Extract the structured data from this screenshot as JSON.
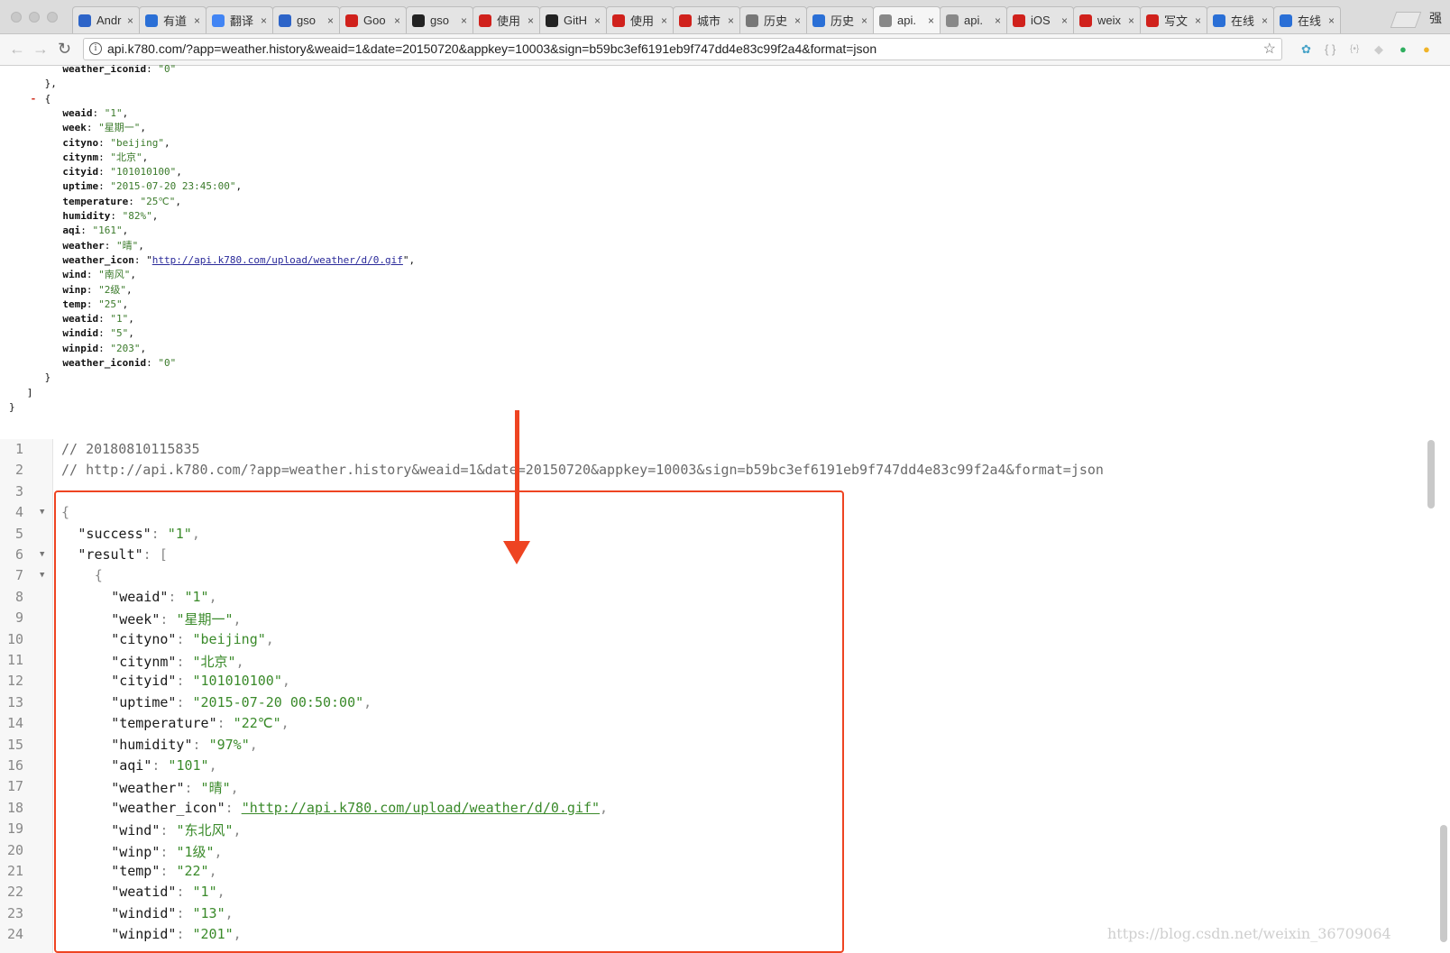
{
  "tabs": [
    {
      "title": "Andr",
      "icon": "paw-icon",
      "color": "#2d64c8"
    },
    {
      "title": "有道",
      "icon": "note-icon",
      "color": "#2a6fd6"
    },
    {
      "title": "翻译",
      "icon": "google-icon",
      "color": "#4285f4"
    },
    {
      "title": "gso",
      "icon": "paw-icon",
      "color": "#2d64c8"
    },
    {
      "title": "Goo",
      "icon": "csdn-icon",
      "color": "#d0211c"
    },
    {
      "title": "gso",
      "icon": "github-icon",
      "color": "#222222"
    },
    {
      "title": "使用",
      "icon": "csdn-icon",
      "color": "#d0211c"
    },
    {
      "title": "GitH",
      "icon": "github-icon",
      "color": "#222222"
    },
    {
      "title": "使用",
      "icon": "csdn-icon",
      "color": "#d0211c"
    },
    {
      "title": "城市",
      "icon": "csdn-icon",
      "color": "#d0211c"
    },
    {
      "title": "历史",
      "icon": "page-icon",
      "color": "#777777"
    },
    {
      "title": "历史",
      "icon": "share-icon",
      "color": "#2a6fd6"
    },
    {
      "title": "api.",
      "icon": "k-icon",
      "color": "#888888"
    },
    {
      "title": "api.",
      "icon": "k-icon",
      "color": "#888888"
    },
    {
      "title": "iOS",
      "icon": "csdn-icon",
      "color": "#d0211c"
    },
    {
      "title": "weix",
      "icon": "csdn-icon",
      "color": "#d0211c"
    },
    {
      "title": "写文",
      "icon": "csdn-icon",
      "color": "#d0211c"
    },
    {
      "title": "在线",
      "icon": "code-icon",
      "color": "#2a6fd6"
    },
    {
      "title": "在线",
      "icon": "code-icon",
      "color": "#2a6fd6"
    }
  ],
  "profile_label": "强",
  "url": "api.k780.com/?app=weather.history&weaid=1&date=20150720&appkey=10003&sign=b59bc3ef6191eb9f747dd4e83c99f2a4&format=json",
  "raw_lines": [
    {
      "indent": 9,
      "key": "weather_iconid",
      "value": "\"0\"",
      "trail": ""
    },
    {
      "indent": 6,
      "plain": "},"
    },
    {
      "indent": 6,
      "plain": "{",
      "minus": "-"
    },
    {
      "indent": 9,
      "key": "weaid",
      "value": "\"1\"",
      "trail": ","
    },
    {
      "indent": 9,
      "key": "week",
      "value": "\"星期一\"",
      "trail": ","
    },
    {
      "indent": 9,
      "key": "cityno",
      "value": "\"beijing\"",
      "trail": ","
    },
    {
      "indent": 9,
      "key": "citynm",
      "value": "\"北京\"",
      "trail": ","
    },
    {
      "indent": 9,
      "key": "cityid",
      "value": "\"101010100\"",
      "trail": ","
    },
    {
      "indent": 9,
      "key": "uptime",
      "value": "\"2015-07-20 23:45:00\"",
      "trail": ","
    },
    {
      "indent": 9,
      "key": "temperature",
      "value": "\"25℃\"",
      "trail": ","
    },
    {
      "indent": 9,
      "key": "humidity",
      "value": "\"82%\"",
      "trail": ","
    },
    {
      "indent": 9,
      "key": "aqi",
      "value": "\"161\"",
      "trail": ","
    },
    {
      "indent": 9,
      "key": "weather",
      "value": "\"晴\"",
      "trail": ","
    },
    {
      "indent": 9,
      "key": "weather_icon",
      "link": "http://api.k780.com/upload/weather/d/0.gif",
      "trail": ","
    },
    {
      "indent": 9,
      "key": "wind",
      "value": "\"南风\"",
      "trail": ","
    },
    {
      "indent": 9,
      "key": "winp",
      "value": "\"2级\"",
      "trail": ","
    },
    {
      "indent": 9,
      "key": "temp",
      "value": "\"25\"",
      "trail": ","
    },
    {
      "indent": 9,
      "key": "weatid",
      "value": "\"1\"",
      "trail": ","
    },
    {
      "indent": 9,
      "key": "windid",
      "value": "\"5\"",
      "trail": ","
    },
    {
      "indent": 9,
      "key": "winpid",
      "value": "\"203\"",
      "trail": ","
    },
    {
      "indent": 9,
      "key": "weather_iconid",
      "value": "\"0\"",
      "trail": ""
    },
    {
      "indent": 6,
      "plain": "}"
    },
    {
      "indent": 3,
      "plain": "]"
    },
    {
      "indent": 0,
      "plain": "}"
    }
  ],
  "viewer_lines": [
    {
      "num": "1",
      "kind": "comment",
      "text": "// 20180810115835"
    },
    {
      "num": "2",
      "kind": "comment",
      "text": "// http://api.k780.com/?app=weather.history&weaid=1&date=20150720&appkey=10003&sign=b59bc3ef6191eb9f747dd4e83c99f2a4&format=json"
    },
    {
      "num": "3",
      "kind": "blank",
      "text": ""
    },
    {
      "num": "4",
      "kind": "punc",
      "text": "{",
      "indent": 0,
      "fold": true
    },
    {
      "num": "5",
      "kind": "kv",
      "key": "success",
      "value": "1",
      "indent": 2,
      "trail": ","
    },
    {
      "num": "6",
      "kind": "kopen",
      "key": "result",
      "open": "[",
      "indent": 2,
      "fold": true
    },
    {
      "num": "7",
      "kind": "punc",
      "text": "{",
      "indent": 4,
      "fold": true
    },
    {
      "num": "8",
      "kind": "kv",
      "key": "weaid",
      "value": "1",
      "indent": 6,
      "trail": ","
    },
    {
      "num": "9",
      "kind": "kv",
      "key": "week",
      "value": "星期一",
      "indent": 6,
      "trail": ","
    },
    {
      "num": "10",
      "kind": "kv",
      "key": "cityno",
      "value": "beijing",
      "indent": 6,
      "trail": ","
    },
    {
      "num": "11",
      "kind": "kv",
      "key": "citynm",
      "value": "北京",
      "indent": 6,
      "trail": ","
    },
    {
      "num": "12",
      "kind": "kv",
      "key": "cityid",
      "value": "101010100",
      "indent": 6,
      "trail": ","
    },
    {
      "num": "13",
      "kind": "kv",
      "key": "uptime",
      "value": "2015-07-20 00:50:00",
      "indent": 6,
      "trail": ","
    },
    {
      "num": "14",
      "kind": "kv",
      "key": "temperature",
      "value": "22℃",
      "indent": 6,
      "trail": ","
    },
    {
      "num": "15",
      "kind": "kv",
      "key": "humidity",
      "value": "97%",
      "indent": 6,
      "trail": ","
    },
    {
      "num": "16",
      "kind": "kv",
      "key": "aqi",
      "value": "101",
      "indent": 6,
      "trail": ","
    },
    {
      "num": "17",
      "kind": "kv",
      "key": "weather",
      "value": "晴",
      "indent": 6,
      "trail": ","
    },
    {
      "num": "18",
      "kind": "klink",
      "key": "weather_icon",
      "value": "\"http://api.k780.com/upload/weather/d/0.gif\"",
      "indent": 6,
      "trail": ","
    },
    {
      "num": "19",
      "kind": "kv",
      "key": "wind",
      "value": "东北风",
      "indent": 6,
      "trail": ","
    },
    {
      "num": "20",
      "kind": "kv",
      "key": "winp",
      "value": "1级",
      "indent": 6,
      "trail": ","
    },
    {
      "num": "21",
      "kind": "kv",
      "key": "temp",
      "value": "22",
      "indent": 6,
      "trail": ","
    },
    {
      "num": "22",
      "kind": "kv",
      "key": "weatid",
      "value": "1",
      "indent": 6,
      "trail": ","
    },
    {
      "num": "23",
      "kind": "kv",
      "key": "windid",
      "value": "13",
      "indent": 6,
      "trail": ","
    },
    {
      "num": "24",
      "kind": "kv",
      "key": "winpid",
      "value": "201",
      "indent": 6,
      "trail": ","
    }
  ],
  "watermark": "https://blog.csdn.net/weixin_36709064",
  "annotation_color": "#ee4422"
}
